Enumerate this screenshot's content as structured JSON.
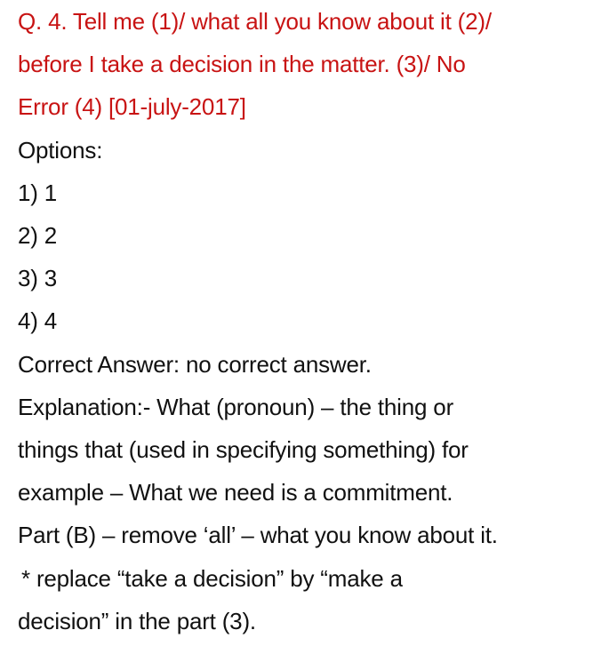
{
  "question": {
    "lines": [
      "Q. 4. Tell me (1)/ what all you know about it (2)/",
      "before I take a decision in the matter. (3)/ No",
      "Error (4) [01-july-2017]"
    ]
  },
  "options": {
    "heading": "Options:",
    "items": [
      "1) 1",
      "2) 2",
      "3) 3",
      "4) 4"
    ]
  },
  "answer": {
    "text": "Correct Answer: no correct answer."
  },
  "explanation": {
    "lines": [
      "Explanation:-  What (pronoun)  – the thing or",
      "things that (used in specifying something) for",
      "example – What we need is a commitment.",
      "Part (B) – remove ‘all’ – what you know about it.",
      " * replace “take a decision” by “make a",
      "decision” in the part (3)."
    ]
  },
  "colors": {
    "question": "#c81313",
    "body": "#111111",
    "background": "#ffffff"
  }
}
